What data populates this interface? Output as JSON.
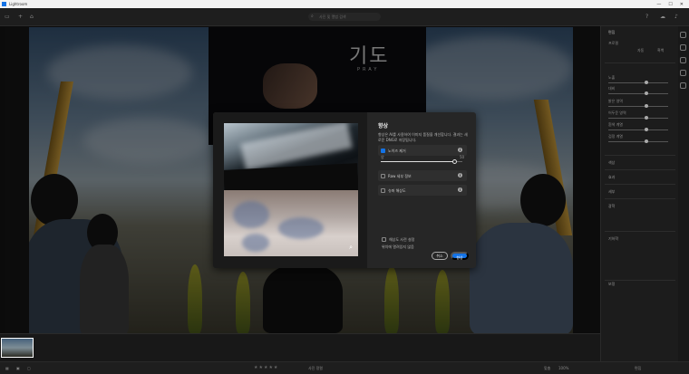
{
  "window": {
    "app_title": "Lightroom",
    "controls": [
      "—",
      "☐",
      "✕"
    ]
  },
  "toolbar": {
    "search_placeholder": "사진 및 앨범 검색",
    "right_icons": [
      "help-icon",
      "cloud-icon",
      "bell-icon"
    ]
  },
  "photo": {
    "poster_title": "기도",
    "poster_subtitle": "PRAY"
  },
  "right_panel": {
    "title": "편집",
    "rows": [
      "프로필",
      "자동",
      "흑백",
      "노출",
      "대비",
      "밝은 영역",
      "어두운 영역",
      "흰색 계열",
      "검정 계열"
    ],
    "sections": [
      "색상",
      "효과",
      "세부",
      "광학",
      "기하학",
      "보정"
    ]
  },
  "dialog": {
    "title": "향상",
    "description": "향상은 AI를 사용하여 이미지 품질을 개선합니다. 결과는 새로운 DNG로 저장됩니다.",
    "options": [
      {
        "label": "노이즈 제거",
        "checked": true
      },
      {
        "label": "Raw 세부 정보",
        "checked": false
      },
      {
        "label": "슈퍼 해상도",
        "checked": false
      }
    ],
    "amount_label": "양",
    "amount_value": "50",
    "amount_fraction": 0.9,
    "save_label": "해상도 사전 설정",
    "save_sub": "위치에 열려있지 않음",
    "cancel_label": "취소",
    "ok_label": "향상"
  },
  "bottom": {
    "fit_label": "맞춤",
    "zoom_label": "100%",
    "sort_label": "사진 정렬"
  },
  "colors": {
    "accent": "#1473e6"
  }
}
